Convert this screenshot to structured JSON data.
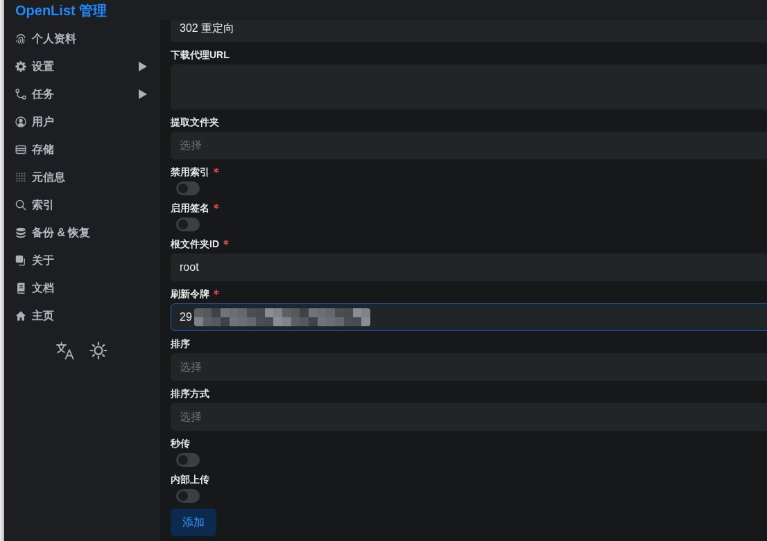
{
  "header": {
    "title": "OpenList 管理"
  },
  "sidebar": {
    "items": [
      {
        "label": "个人资料",
        "kind": "link"
      },
      {
        "label": "设置",
        "kind": "group",
        "expanded": false
      },
      {
        "label": "任务",
        "kind": "group",
        "expanded": false
      },
      {
        "label": "用户",
        "kind": "link"
      },
      {
        "label": "存储",
        "kind": "link"
      },
      {
        "label": "元信息",
        "kind": "link"
      },
      {
        "label": "索引",
        "kind": "link"
      },
      {
        "label": "备份 & 恢复",
        "kind": "link"
      },
      {
        "label": "关于",
        "kind": "link"
      },
      {
        "label": "文档",
        "kind": "link"
      },
      {
        "label": "主页",
        "kind": "link"
      }
    ]
  },
  "form": {
    "fields": [
      {
        "kind": "select",
        "value": "302 重定向",
        "focused": false
      },
      {
        "kind": "textarea",
        "label": "下载代理URL",
        "required": false,
        "focused": false
      },
      {
        "kind": "select",
        "label": "提取文件夹",
        "required": false,
        "placeholder": "选择",
        "focused": false
      },
      {
        "kind": "toggle",
        "label": "禁用索引",
        "required": true,
        "on": false
      },
      {
        "kind": "toggle",
        "label": "启用签名",
        "required": true,
        "on": false
      },
      {
        "kind": "input",
        "label": "根文件夹ID",
        "required": true,
        "value": "root",
        "focused": false,
        "redacted": false
      },
      {
        "kind": "input",
        "label": "刷新令牌",
        "required": true,
        "value": "29",
        "focused": true,
        "redacted": true
      },
      {
        "kind": "select",
        "label": "排序",
        "required": false,
        "placeholder": "选择",
        "focused": false
      },
      {
        "kind": "select",
        "label": "排序方式",
        "required": false,
        "placeholder": "选择",
        "focused": false
      },
      {
        "kind": "toggle",
        "label": "秒传",
        "required": false,
        "on": false
      },
      {
        "kind": "toggle",
        "label": "内部上传",
        "required": false,
        "on": false
      }
    ],
    "submit_button": "添加"
  }
}
